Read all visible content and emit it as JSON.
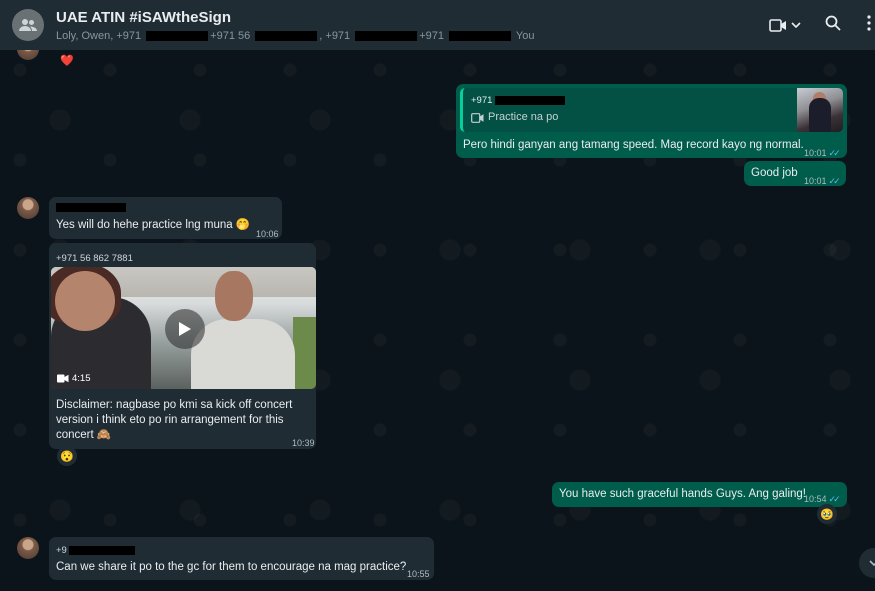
{
  "header": {
    "title": "UAE ATIN #iSAWtheSign",
    "members": [
      "Loly, Owen, +971 ",
      "+971 56 ",
      ", +971 ",
      "+971 ",
      " You"
    ]
  },
  "messages": {
    "reply_sender": "+971",
    "reply_quote": "Practice na po",
    "reply_text": "Pero hindi ganyan ang tamang speed. Mag record kayo ng normal.",
    "reply_time": "10:01",
    "goodjob_text": "Good job",
    "goodjob_time": "10:01",
    "willdo_text": "Yes will do hehe practice lng muna 🤭",
    "willdo_time": "10:06",
    "video_sender": "+971 56 862 7881",
    "video_duration": "4:15",
    "video_caption": "Disclaimer: nagbase po kmi sa kick off concert version i think eto po rin arrangement for this concert 🙈",
    "video_time": "10:39",
    "video_reaction": "😯",
    "graceful_text": "You have such graceful hands Guys. Ang galing!",
    "graceful_time": "10:54",
    "graceful_reaction": "🥹",
    "share_sender": "+9",
    "share_text": "Can we share it po to the gc for them to encourage na mag practice?",
    "share_time": "10:55",
    "top_reaction": "❤️"
  },
  "colors": {
    "incoming": "#202c33",
    "outgoing": "#005c4b",
    "read_ticks": "#53bdeb"
  },
  "icons": [
    "group-avatar-icon",
    "video-call-icon",
    "chevron-down-icon",
    "search-icon",
    "menu-icon",
    "video-camera-icon",
    "play-icon",
    "chevron-down-icon"
  ]
}
